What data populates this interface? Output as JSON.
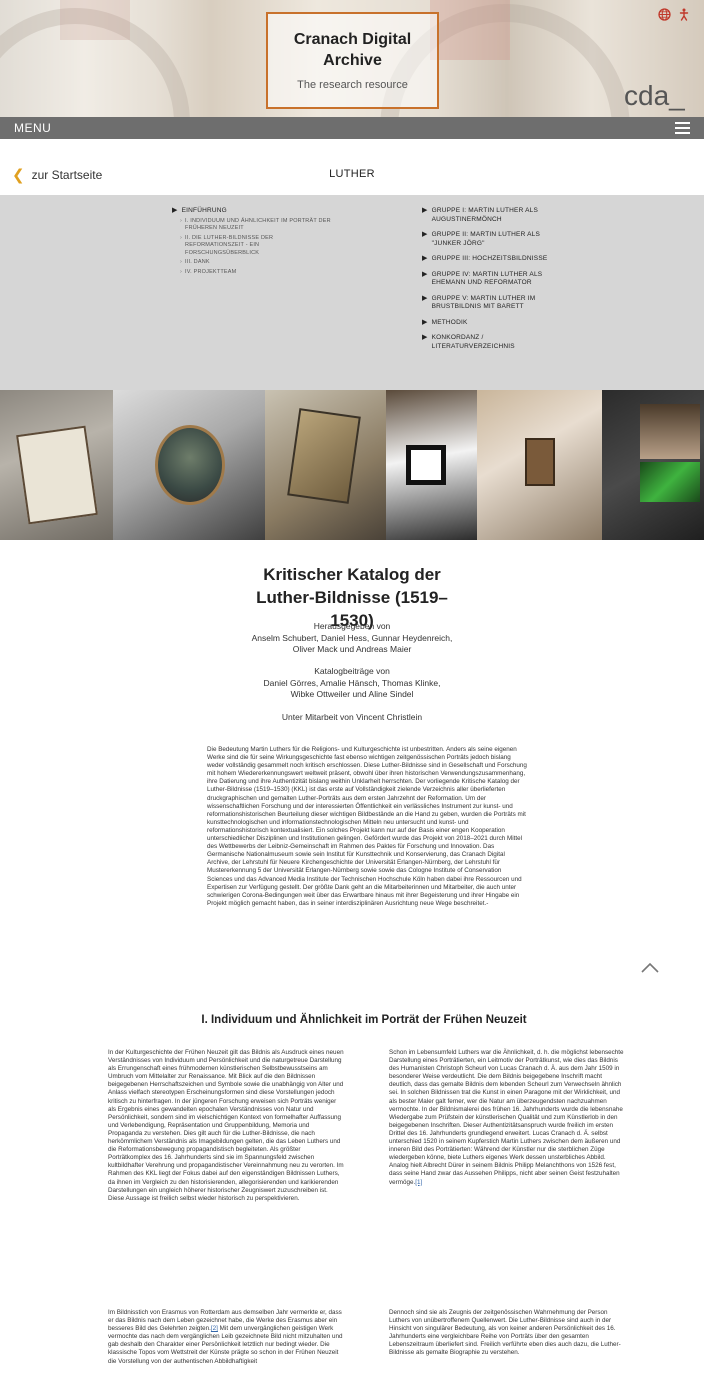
{
  "header": {
    "logo_title": "Cranach Digital Archive",
    "logo_subtitle": "The research resource",
    "brand_mark": "cda_",
    "icons": [
      "globe-icon",
      "accessibility-icon"
    ]
  },
  "menubar": {
    "label": "MENU"
  },
  "nav": {
    "back_label": "zur Startseite",
    "page_title": "LUTHER"
  },
  "toc": {
    "left": [
      {
        "label": "EINFÜHRUNG",
        "level": 1
      },
      {
        "label": "I. INDIVIDUUM UND ÄHNLICHKEIT IM PORTRÄT DER FRÜHEREN NEUZEIT",
        "level": 2
      },
      {
        "label": "II. DIE LUTHER-BILDNISSE DER REFORMATIONSZEIT - EIN FORSCHUNGSÜBERBLICK",
        "level": 2
      },
      {
        "label": "III. DANK",
        "level": 2
      },
      {
        "label": "IV. PROJEKTTEAM",
        "level": 2
      }
    ],
    "right": [
      {
        "label": "GRUPPE I: MARTIN LUTHER ALS AUGUSTINERMÖNCH"
      },
      {
        "label": "GRUPPE II: MARTIN LUTHER ALS \"JUNKER JÖRG\""
      },
      {
        "label": "GRUPPE III: HOCHZEITSBILDNISSE"
      },
      {
        "label": "GRUPPE IV: MARTIN LUTHER ALS EHEMANN UND REFORMATOR"
      },
      {
        "label": "GRUPPE V: MARTIN LUTHER IM BRUSTBILDNIS MIT BARETT"
      },
      {
        "label": "METHODIK"
      },
      {
        "label": "KONKORDANZ / LITERATURVERZEICHNIS"
      }
    ]
  },
  "main": {
    "title": "Kritischer Katalog der Luther-Bildnisse (1519–1530)",
    "editors_label": "Herausgegeben von",
    "editors": "Anselm Schubert, Daniel Hess, Gunnar Heydenreich, Oliver Mack und Andreas Maier",
    "contributors_label": "Katalogbeiträge von",
    "contributors": "Daniel Görres, Amalie Hänsch, Thomas Klinke, Wibke Ottweiler und Aline Sindel",
    "collaboration": "Unter Mitarbeit von Vincent Christlein",
    "intro": "Die Bedeutung Martin Luthers für die Religions- und Kulturgeschichte ist unbestritten. Anders als seine eigenen Werke sind die für seine Wirkungsgeschichte fast ebenso wichtigen zeitgenössischen Porträts jedoch bislang weder vollständig gesammelt noch kritisch erschlossen. Diese Luther-Bildnisse sind in Gesellschaft und Forschung mit hohem Wiedererkennungswert weltweit präsent, obwohl über ihren historischen Verwendungszusammenhang, ihre Datierung und ihre Authentizität bislang weithin Unklarheit herrschten. Der vorliegende Kritische Katalog der Luther-Bildnisse (1519–1530) (KKL) ist das erste auf Vollständigkeit zielende Verzeichnis aller überlieferten druckgraphischen und gemalten Luther-Porträts aus dem ersten Jahrzehnt der Reformation. Um der wissenschaftlichen Forschung und der interessierten Öffentlichkeit ein verlässliches Instrument zur kunst- und reformationshistorischen Beurteilung dieser wichtigen Bildbestände an die Hand zu geben, wurden die Porträts mit kunsttechnologischen und informationstechnologischen Mitteln neu untersucht und kunst- und reformationshistorisch kontextualisiert. Ein solches Projekt kann nur auf der Basis einer engen Kooperation unterschiedlicher Disziplinen und Institutionen gelingen. Gefördert wurde das Projekt von 2018–2021 durch Mittel des Wettbewerbs der Leibniz-Gemeinschaft im Rahmen des Paktes für Forschung und Innovation. Das Germanische Nationalmuseum sowie sein Institut für Kunsttechnik und Konservierung, das Cranach Digital Archive, der Lehrstuhl für Neuere Kirchengeschichte der Universität Erlangen-Nürnberg, der Lehrstuhl für Mustererkennung 5 der Universität Erlangen-Nürnberg sowie sowie das Cologne Institute of Conservation Sciences und das Advanced Media Institute der Technischen Hochschule Köln haben dabei ihre Ressourcen und Expertisen zur Verfügung gestellt. Der größte Dank geht an die Mitarbeiterinnen und Mitarbeiter, die auch unter schwierigen Corona-Bedingungen weit über das Erwartbare hinaus mit ihrer Begeisterung und ihrer Hingabe ein Projekt möglich gemacht haben, das in seiner interdisziplinären Ausrichtung neue Wege beschreitet.-",
    "section_heading": "I. Individuum und Ähnlichkeit im Porträt der Frühen Neuzeit",
    "col1": "In der Kulturgeschichte der Frühen Neuzeit gilt das Bildnis als Ausdruck eines neuen Verständnisses von Individuum und Persönlichkeit und die naturgetreue Darstellung als Errungenschaft eines frühmodernen künstlerischen Selbstbewusstseins am Umbruch vom Mittelalter zur Renaissance. Mit Blick auf die den Bildnissen beigegebenen Herrschaftszeichen und Symbole sowie die unabhängig von Alter und Anlass vielfach stereotypen Erscheinungsformen sind diese Vorstellungen jedoch kritisch zu hinterfragen. In der jüngeren Forschung erweisen sich Porträts weniger als Ergebnis eines gewandelten epochalen Verständnisses von Natur und Persönlichkeit, sondern sind im vielschichtigen Kontext von formelhafter Auffassung und Verlebendigung, Repräsentation und Gruppenbildung, Memoria und Propaganda zu verstehen. Dies gilt auch für die Luther-Bildnisse, die nach herkömmlichem Verständnis als Imagebildungen gelten, die das Leben Luthers und die Reformationsbewegung propagandistisch begleiteten. Als größter Porträtkomplex des 16. Jahrhunderts sind sie im Spannungsfeld zwischen kultbildhafter Verehrung und propagandistischer Vereinnahmung neu zu verorten. Im Rahmen des KKL liegt der Fokus dabei auf den eigenständigen Bildnissen Luthers, da ihnen im Vergleich zu den historisierenden, allegorisierenden und karikierenden Darstellungen ein ungleich höherer historischer Zeugniswert zuzuschreiben ist. Diese Aussage ist freilich selbst wieder historisch zu perspektivieren.",
    "col2_text": "Schon im Lebensumfeld Luthers war die Ähnlichkeit, d. h. die möglichst lebensechte Darstellung eines Porträtierten, ein Leitmotiv der Porträtkunst, wie dies das Bildnis des Humanisten Christoph Scheurl von Lucas Cranach d. Ä. aus dem Jahr 1509 in besonderer Weise verdeutlicht. Die dem Bildnis beigegebene Inschrift macht deutlich, dass das gemalte Bildnis dem lebenden Scheurl zum Verwechseln ähnlich sei. In solchen Bildnissen trat die Kunst in einen Paragone mit der Wirklichkeit, und als bester Maler galt ferner, wer die Natur am überzeugendsten nachzuahmen vermochte. In der Bildnismalerei des frühen 16. Jahrhunderts wurde die lebensnahe Wiedergabe zum Prüfstein der künstlerischen Qualität und zum Künstlerlob in den beigegebenen Inschriften. Dieser Authentizitätsanspruch wurde freilich im ersten Drittel des 16. Jahrhunderts grundlegend erweitert. Lucas Cranach d. Ä. selbst unterschied 1520 in seinem Kupferstich Martin Luthers zwischen dem äußeren und inneren Bild des Porträtierten: Während der Künstler nur die sterblichen Züge wiedergeben könne, biete Luthers eigenes Werk dessen unsterbliches Abbild. Analog hielt Albrecht Dürer in seinem Bildnis Philipp Melanchthons von 1526 fest, dass seine Hand zwar das Aussehen Philipps, nicht aber seinen Geist festzuhalten vermöge.",
    "col2_footnote": "[1]",
    "col3_text": "Im Bildnisstich von Erasmus von Rotterdam aus demselben Jahr vermerkte er, dass er das Bildnis nach dem Leben gezeichnet habe, die Werke des Erasmus aber ein besseres Bild des Gelehrten zeigten.",
    "col3_footnote": "[2]",
    "col3_text2": " Mit dem unvergänglichen geistigen Werk vermochte das nach dem vergänglichen Leib gezeichnete Bild nicht mitzuhalten und gab deshalb den Charakter einer Persönlichkeit letztlich nur bedingt wieder. Die klassische Topos vom Wettstreit der Künste prägte so schon in der Frühen Neuzeit die Vorstellung von der authentischen Abbildhaftigkeit",
    "col4": "Dennoch sind sie als Zeugnis der zeitgenössischen Wahrnehmung der Person Luthers von unübertroffenem Quellenwert. Die Luther-Bildnisse sind auch in der Hinsicht von singulärer Bedeutung, als von keiner anderen Persönlichkeit des 16. Jahrhunderts eine vergleichbare Reihe von Porträts über den gesamten Lebenszeitraum überliefert sind. Freilich verführte eben dies auch dazu, die Luther-Bildnisse als gemalte Biographie zu verstehen."
  },
  "colors": {
    "accent": "#c8712b",
    "menubar": "#6e6e6e",
    "toc_bg": "#d6d6d6",
    "back_chevron": "#e0a020"
  }
}
